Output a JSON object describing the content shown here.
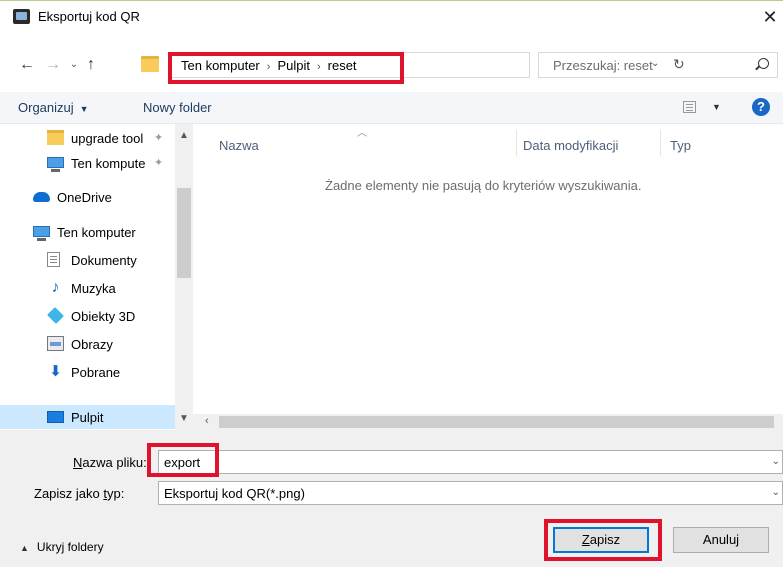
{
  "window": {
    "title": "Eksportuj kod QR",
    "close_glyph": "✕"
  },
  "address": {
    "crumbs": [
      "Ten komputer",
      "Pulpit",
      "reset"
    ],
    "search_placeholder": "Przeszukaj: reset"
  },
  "toolbar": {
    "organize_label": "Organizuj",
    "new_folder_label": "Nowy folder",
    "help_label": "?"
  },
  "navpane": {
    "items": [
      {
        "label": "upgrade tool",
        "icon": "folder-icon",
        "pinned": true
      },
      {
        "label": "Ten kompute",
        "icon": "computer-icon",
        "pinned": true
      },
      {
        "label": "OneDrive",
        "icon": "cloud-icon",
        "pinned": false
      },
      {
        "label": "Ten komputer",
        "icon": "computer-icon",
        "pinned": false
      },
      {
        "label": "Dokumenty",
        "icon": "document-icon",
        "pinned": false
      },
      {
        "label": "Muzyka",
        "icon": "music-icon",
        "pinned": false
      },
      {
        "label": "Obiekty 3D",
        "icon": "cube-icon",
        "pinned": false
      },
      {
        "label": "Obrazy",
        "icon": "picture-icon",
        "pinned": false
      },
      {
        "label": "Pobrane",
        "icon": "download-icon",
        "pinned": false
      },
      {
        "label": "Pulpit",
        "icon": "desktop-icon",
        "pinned": false,
        "selected": true
      }
    ]
  },
  "filepane": {
    "columns": [
      "Nazwa",
      "Data modyfikacji",
      "Typ"
    ],
    "empty_message": "Żadne elementy nie pasują do kryteriów wyszukiwania."
  },
  "form": {
    "filename_label_u": "N",
    "filename_label_rest": "azwa pliku:",
    "filename_value": "export",
    "type_label_pre": "Zapisz jako ",
    "type_label_u": "t",
    "type_label_rest": "yp:",
    "type_value": "Eksportuj kod QR(*.png)"
  },
  "footer": {
    "hide_folders_label": "Ukryj foldery",
    "save_label_u": "Z",
    "save_label_rest": "apisz",
    "cancel_label": "Anuluj"
  },
  "colors": {
    "highlight": "#e0132f",
    "selection": "#cce8ff",
    "accent": "#0078d7"
  }
}
